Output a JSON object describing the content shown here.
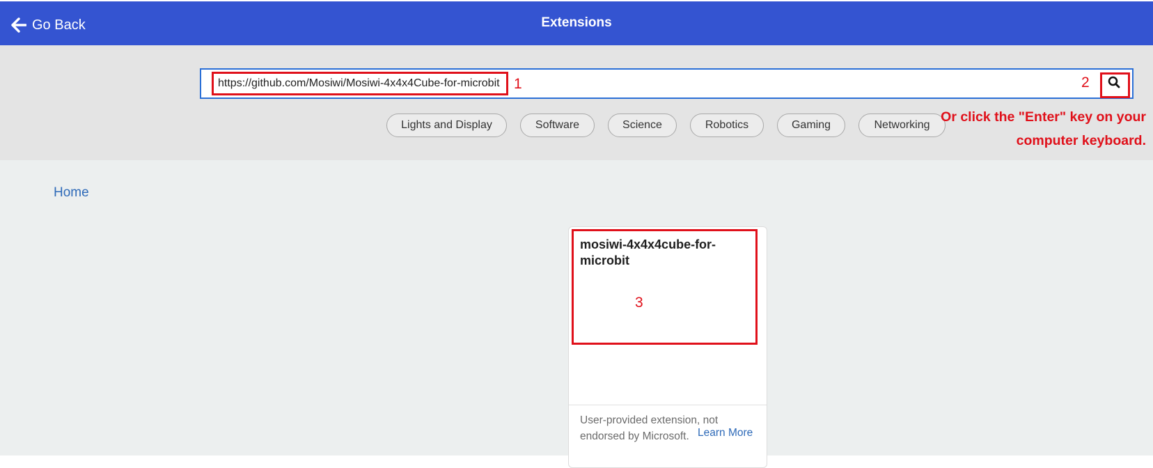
{
  "header": {
    "back_label": "Go Back",
    "title": "Extensions"
  },
  "search": {
    "value": "https://github.com/Mosiwi/Mosiwi-4x4x4Cube-for-microbit"
  },
  "categories": [
    "Lights and Display",
    "Software",
    "Science",
    "Robotics",
    "Gaming",
    "Networking"
  ],
  "breadcrumb": {
    "home": "Home"
  },
  "result_card": {
    "title": "mosiwi-4x4x4cube-for-microbit",
    "footer_text": "User-provided extension, not endorsed by Microsoft.",
    "learn_more": "Learn More"
  },
  "annotations": {
    "step1": "1",
    "step2": "2",
    "step3": "3",
    "note": "Or click the \"Enter\" key on your computer keyboard."
  },
  "colors": {
    "header_bg": "#3454d1",
    "annotation": "#e0101a",
    "link": "#2e6ab8"
  }
}
